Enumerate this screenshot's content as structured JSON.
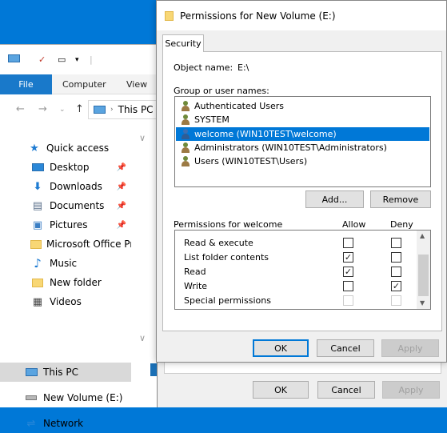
{
  "explorer": {
    "ribbon_tabs": [
      "File",
      "Computer",
      "View"
    ],
    "address": "This PC",
    "nav_items": [
      {
        "label": "Quick access",
        "icon": "star-icon",
        "pinned": false
      },
      {
        "label": "Desktop",
        "icon": "desktop-icon",
        "pinned": true
      },
      {
        "label": "Downloads",
        "icon": "download-icon",
        "pinned": true
      },
      {
        "label": "Documents",
        "icon": "documents-icon",
        "pinned": true
      },
      {
        "label": "Pictures",
        "icon": "pictures-icon",
        "pinned": true
      },
      {
        "label": "Microsoft Office Pro",
        "icon": "folder-icon",
        "pinned": false
      },
      {
        "label": "Music",
        "icon": "music-icon",
        "pinned": false
      },
      {
        "label": "New folder",
        "icon": "folder-icon",
        "pinned": false
      },
      {
        "label": "Videos",
        "icon": "videos-icon",
        "pinned": false
      },
      {
        "label": "This PC",
        "icon": "computer-icon",
        "pinned": false,
        "selected": true
      },
      {
        "label": "New Volume (E:)",
        "icon": "drive-icon",
        "pinned": false
      },
      {
        "label": "Network",
        "icon": "network-icon",
        "pinned": false
      }
    ]
  },
  "dialog": {
    "title": "Permissions for New Volume (E:)",
    "tab": "Security",
    "object_name_label": "Object name:",
    "object_name_value": "E:\\",
    "group_label": "Group or user names:",
    "groups": [
      {
        "name": "Authenticated Users",
        "selected": false
      },
      {
        "name": "SYSTEM",
        "selected": false
      },
      {
        "name": "welcome (WIN10TEST\\welcome)",
        "selected": true
      },
      {
        "name": "Administrators (WIN10TEST\\Administrators)",
        "selected": false
      },
      {
        "name": "Users (WIN10TEST\\Users)",
        "selected": false
      }
    ],
    "add_label": "Add...",
    "remove_label": "Remove",
    "perm_header": "Permissions for welcome",
    "allow_header": "Allow",
    "deny_header": "Deny",
    "permissions": [
      {
        "name": "Read & execute",
        "allow": false,
        "deny": false,
        "disabled": false
      },
      {
        "name": "List folder contents",
        "allow": true,
        "deny": false,
        "disabled": false
      },
      {
        "name": "Read",
        "allow": true,
        "deny": false,
        "disabled": false
      },
      {
        "name": "Write",
        "allow": false,
        "deny": true,
        "disabled": false
      },
      {
        "name": "Special permissions",
        "allow": false,
        "deny": false,
        "disabled": true
      }
    ],
    "ok_label": "OK",
    "cancel_label": "Cancel",
    "apply_label": "Apply"
  },
  "back_dialog": {
    "ok_label": "OK",
    "cancel_label": "Cancel",
    "apply_label": "Apply"
  },
  "colors": {
    "accent": "#0078d7",
    "desktop": "#0078d7"
  }
}
